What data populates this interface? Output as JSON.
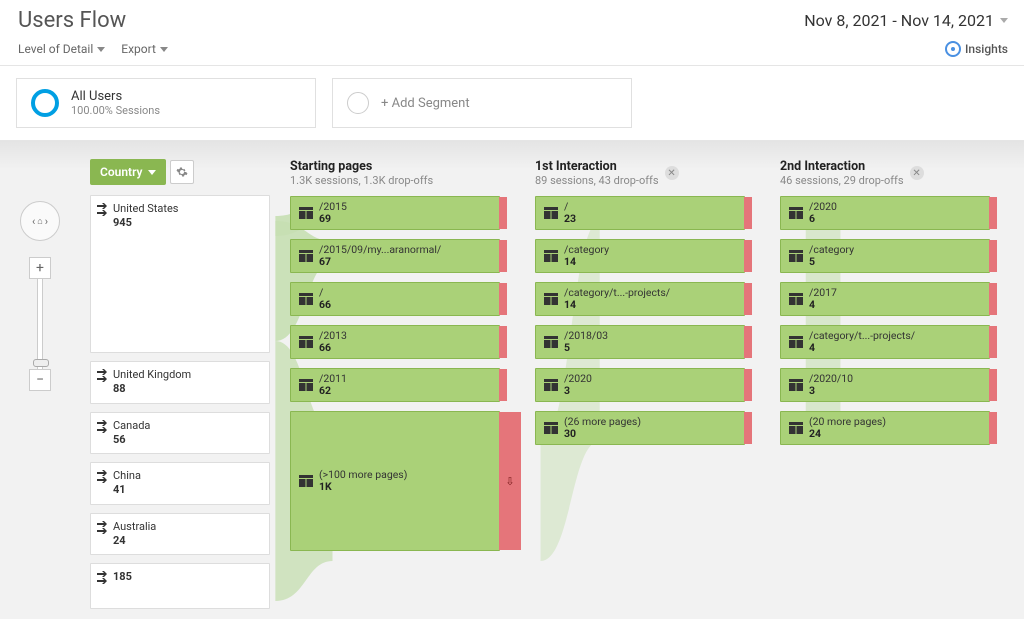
{
  "header": {
    "title": "Users Flow",
    "date_range": "Nov 8, 2021 - Nov 14, 2021"
  },
  "toolbar": {
    "level_label": "Level of Detail",
    "export_label": "Export",
    "insights_label": "Insights"
  },
  "segments": {
    "primary": {
      "title": "All Users",
      "sub": "100.00% Sessions"
    },
    "add_label": "+ Add Segment"
  },
  "flow": {
    "dimension": {
      "label": "Country"
    },
    "sources": [
      {
        "label": "United States",
        "value": "945"
      },
      {
        "label": "United Kingdom",
        "value": "88"
      },
      {
        "label": "Canada",
        "value": "56"
      },
      {
        "label": "China",
        "value": "41"
      },
      {
        "label": "Australia",
        "value": "24"
      },
      {
        "label": "",
        "value": "185"
      }
    ],
    "columns": [
      {
        "title": "Starting pages",
        "sub": "1.3K sessions, 1.3K drop-offs",
        "nodes": [
          {
            "label": "/2015",
            "value": "69"
          },
          {
            "label": "/2015/09/my...aranormal/",
            "value": "67"
          },
          {
            "label": "/",
            "value": "66"
          },
          {
            "label": "/2013",
            "value": "66"
          },
          {
            "label": "/2011",
            "value": "62"
          },
          {
            "label": "(>100 more pages)",
            "value": "1K",
            "big": true
          }
        ]
      },
      {
        "title": "1st Interaction",
        "sub": "89 sessions, 43 drop-offs",
        "closable": true,
        "nodes": [
          {
            "label": "/",
            "value": "23"
          },
          {
            "label": "/category",
            "value": "14"
          },
          {
            "label": "/category/t...-projects/",
            "value": "14"
          },
          {
            "label": "/2018/03",
            "value": "5"
          },
          {
            "label": "/2020",
            "value": "3"
          },
          {
            "label": "(26 more pages)",
            "value": "30"
          }
        ]
      },
      {
        "title": "2nd Interaction",
        "sub": "46 sessions, 29 drop-offs",
        "closable": true,
        "nodes": [
          {
            "label": "/2020",
            "value": "6"
          },
          {
            "label": "/category",
            "value": "5"
          },
          {
            "label": "/2017",
            "value": "4"
          },
          {
            "label": "/category/t...-projects/",
            "value": "4"
          },
          {
            "label": "/2020/10",
            "value": "3"
          },
          {
            "label": "(20 more pages)",
            "value": "24"
          }
        ]
      }
    ]
  }
}
